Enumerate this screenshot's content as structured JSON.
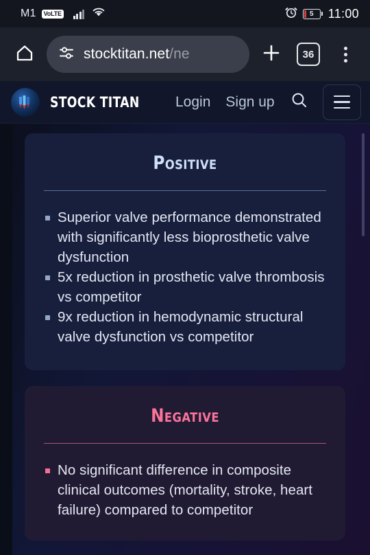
{
  "status_bar": {
    "carrier": "M1",
    "network_badge": "VoLTE",
    "signal_icon": "signal-bars-icon",
    "wifi_icon": "wifi-icon",
    "alarm_icon": "alarm-clock-icon",
    "battery_percent": "5",
    "battery_color": "#d9423f",
    "time": "11:00"
  },
  "browser": {
    "home_icon": "home-icon",
    "site_settings_icon": "tune-sliders-icon",
    "url_domain": "stocktitan.net",
    "url_path": "/ne",
    "url_full": "stocktitan.net/ne",
    "new_tab_icon": "plus-icon",
    "tab_count": "36",
    "menu_icon": "three-dot-menu-icon"
  },
  "site_header": {
    "logo_icon": "stock-titan-logo-icon",
    "brand": "STOCK TITAN",
    "login_label": "Login",
    "signup_label": "Sign up",
    "search_icon": "search-icon",
    "menu_icon": "hamburger-menu-icon"
  },
  "content": {
    "positive_card": {
      "title": "Positive",
      "accent_color": "#cfe0f7",
      "background": "#181f3d",
      "points": [
        "Superior valve performance demonstrated with significantly less bioprosthetic valve dysfunction",
        "5x reduction in prosthetic valve thrombosis vs competitor",
        "9x reduction in hemodynamic structural valve dysfunction vs competitor"
      ]
    },
    "negative_card": {
      "title": "Negative",
      "accent_color": "#fa7499",
      "background": "#211a33",
      "points": [
        "No significant difference in composite clinical outcomes (mortality, stroke, heart failure) compared to competitor"
      ]
    }
  }
}
